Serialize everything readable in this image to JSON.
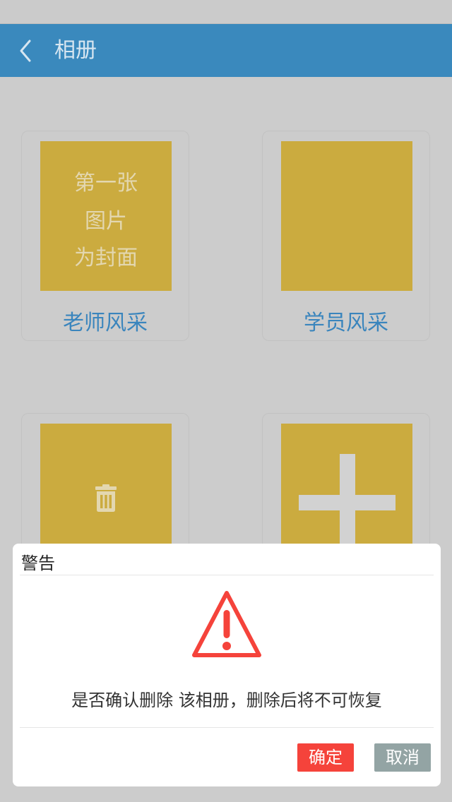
{
  "header": {
    "title": "相册",
    "back_icon": "chevron-left-icon"
  },
  "albums": [
    {
      "name": "老师风采",
      "cover_text": [
        "第一张",
        "图片",
        "为封面"
      ]
    },
    {
      "name": "学员风采"
    },
    {
      "action": "delete",
      "icon": "trash-icon"
    },
    {
      "action": "add",
      "icon": "plus-icon"
    }
  ],
  "dialog": {
    "title": "警告",
    "icon": "warning-triangle-icon",
    "message": "是否确认删除 该相册，删除后将不可恢复",
    "confirm_label": "确定",
    "cancel_label": "取消"
  },
  "colors": {
    "header_bg": "#3a89bd",
    "cover_bg": "#cbab3f",
    "album_name": "#3a85bd",
    "confirm_bg": "#f5433b",
    "cancel_bg": "#93a4a4",
    "warning": "#f5433b"
  }
}
